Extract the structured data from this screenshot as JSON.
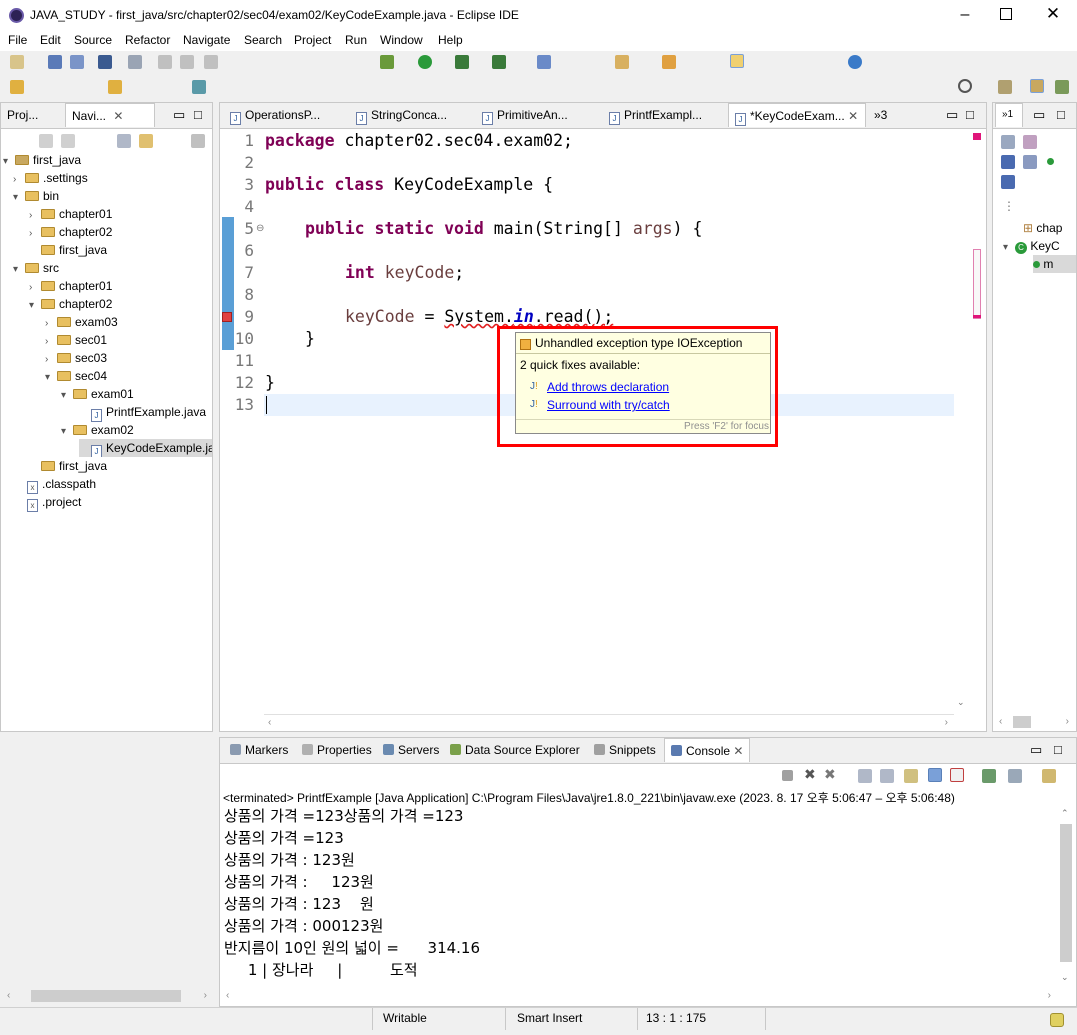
{
  "window": {
    "title": "JAVA_STUDY - first_java/src/chapter02/sec04/exam02/KeyCodeExample.java - Eclipse IDE"
  },
  "menu": [
    "File",
    "Edit",
    "Source",
    "Refactor",
    "Navigate",
    "Search",
    "Project",
    "Run",
    "Window",
    "Help"
  ],
  "left_tabs": [
    "Proj...",
    "Navi..."
  ],
  "tree": [
    {
      "label": "first_java",
      "type": "project"
    },
    {
      "label": ".settings",
      "type": "folder"
    },
    {
      "label": "bin",
      "type": "folder"
    },
    {
      "label": "chapter01",
      "type": "folder"
    },
    {
      "label": "chapter02",
      "type": "folder"
    },
    {
      "label": "first_java",
      "type": "folder"
    },
    {
      "label": "src",
      "type": "folder"
    },
    {
      "label": "chapter01",
      "type": "folder"
    },
    {
      "label": "chapter02",
      "type": "folder"
    },
    {
      "label": "exam03",
      "type": "folder"
    },
    {
      "label": "sec01",
      "type": "folder"
    },
    {
      "label": "sec03",
      "type": "folder"
    },
    {
      "label": "sec04",
      "type": "folder"
    },
    {
      "label": "exam01",
      "type": "folder"
    },
    {
      "label": "PrintfExample.java",
      "type": "java"
    },
    {
      "label": "exam02",
      "type": "folder"
    },
    {
      "label": "KeyCodeExample.ja",
      "type": "java"
    },
    {
      "label": "first_java",
      "type": "folder"
    },
    {
      "label": ".classpath",
      "type": "xml"
    },
    {
      "label": ".project",
      "type": "xml"
    }
  ],
  "editor_tabs": [
    "OperationsP...",
    "StringConca...",
    "PrimitiveAn...",
    "PrintfExampl...",
    "*KeyCodeExam..."
  ],
  "editor_overflow": "»3",
  "code": {
    "line_numbers": [
      "1",
      "2",
      "3",
      "4",
      "5",
      "6",
      "7",
      "8",
      "9",
      "10",
      "11",
      "12",
      "13"
    ],
    "l1_kw": "package",
    "l1_rest": " chapter02.sec04.exam02;",
    "l3_kw": "public class",
    "l3_rest": " KeyCodeExample {",
    "l5_kw": "public static void",
    "l5_rest": " main(String[] ",
    "l5_var": "args",
    "l5_end": ") {",
    "l7_kw": "int",
    "l7_var": " keyCode",
    "l7_end": ";",
    "l9_var": "keyCode",
    "l9_mid": " = ",
    "l9_sys": "System.",
    "l9_in": "in",
    "l9_end": ".read();",
    "l10": "}",
    "l12": "}"
  },
  "quickfix": {
    "title": "Unhandled exception type IOException",
    "count": "2 quick fixes available:",
    "fixes": [
      "Add throws declaration",
      "Surround with try/catch"
    ],
    "hint": "Press 'F2' for focus"
  },
  "outline": {
    "items": [
      "chap",
      "KeyC",
      "m"
    ]
  },
  "bottom_tabs": [
    "Markers",
    "Properties",
    "Servers",
    "Data Source Explorer",
    "Snippets",
    "Console"
  ],
  "console": {
    "header": "<terminated> PrintfExample [Java Application] C:\\Program Files\\Java\\jre1.8.0_221\\bin\\javaw.exe  (2023. 8. 17 오후 5:06:47 – 오후 5:06:48)",
    "lines": [
      "상품의 가격 =123상품의 가격 =123",
      "상품의 가격 =123",
      "상품의 가격 : 123원",
      "상품의 가격 :     123원",
      "상품의 가격 : 123    원",
      "상품의 가격 : 000123원",
      "반지름이 10인 원의 넓이 =      314.16",
      "     1 | 장나라     |          도적"
    ]
  },
  "status": {
    "writable": "Writable",
    "insert": "Smart Insert",
    "position": "13 : 1 : 175"
  },
  "colors": {
    "keyword": "#7f0055",
    "field": "#0000c0",
    "highlight": "#e8f2fe",
    "error": "#ff0000",
    "link": "#0000ff"
  }
}
